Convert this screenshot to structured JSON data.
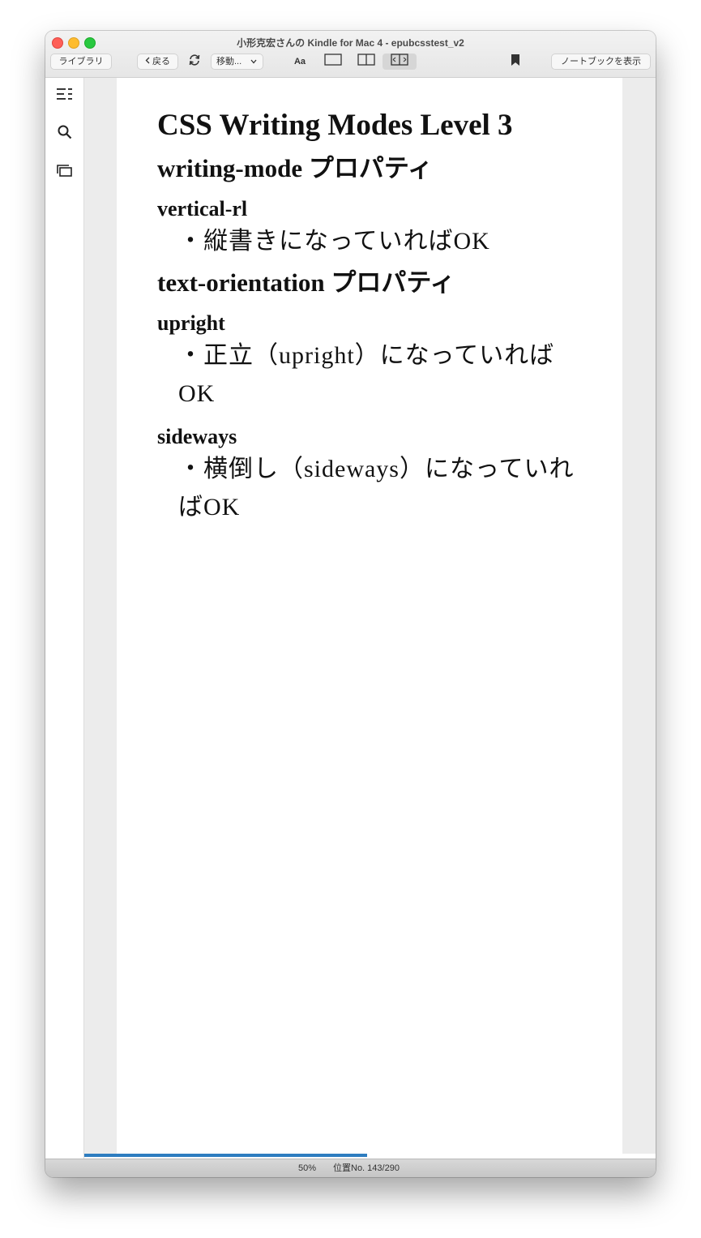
{
  "window": {
    "title": "小形克宏さんの Kindle for Mac 4 - epubcsstest_v2"
  },
  "toolbar": {
    "library_label": "ライブラリ",
    "back_label": "戻る",
    "goto_label": "移動...",
    "font_label": "Aa",
    "notebook_label": "ノートブックを表示"
  },
  "book": {
    "title": "CSS Writing Modes Level 3",
    "sections": [
      {
        "heading": "writing-mode プロパティ",
        "subsections": [
          {
            "heading": "vertical-rl",
            "item": "・縦書きになっていればOK"
          }
        ]
      },
      {
        "heading": "text-orientation プロパティ",
        "subsections": [
          {
            "heading": "upright",
            "item": "・正立（upright）になっていればOK"
          },
          {
            "heading": "sideways",
            "item": "・横倒し（sideways）になっていればOK"
          }
        ]
      }
    ]
  },
  "status": {
    "percent": "50%",
    "progress_fraction": 0.495,
    "location": "位置No. 143/290"
  },
  "colors": {
    "progress": "#2e7dc0",
    "close": "#fe5f57",
    "minimize": "#febc2e",
    "maximize": "#28c840"
  }
}
